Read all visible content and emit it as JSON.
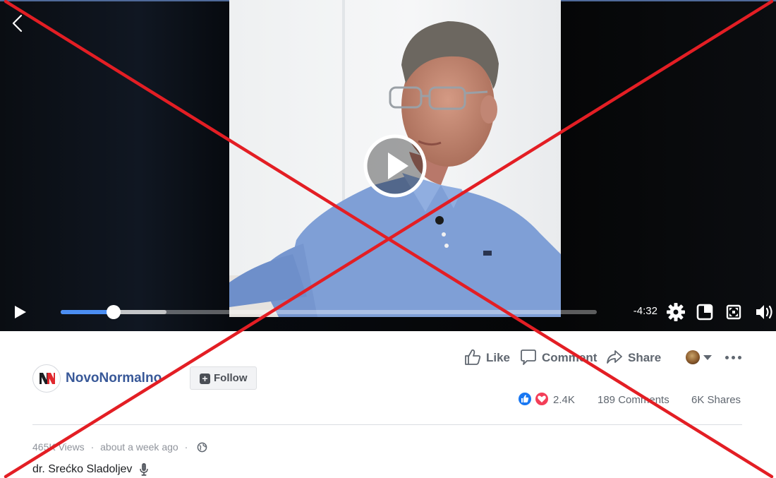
{
  "colors": {
    "accent": "#4b8ef2",
    "link": "#385898",
    "love": "#f33e58",
    "like": "#1877f2",
    "cross": "#e31e24"
  },
  "player": {
    "time_remaining": "-4:32",
    "progress_played": 0.099,
    "progress_buffered": 0.197,
    "icons": [
      "chevron-left-icon",
      "play-icon",
      "gear-icon",
      "picture-in-picture-icon",
      "fullscreen-icon",
      "volume-icon"
    ]
  },
  "post": {
    "page_name": "NovoNormalno",
    "follow_label": "Follow",
    "actions": {
      "like": "Like",
      "comment": "Comment",
      "share": "Share"
    },
    "stats": {
      "reactions": "2.4K",
      "comments": "189 Comments",
      "shares": "6K Shares"
    },
    "views": "465K Views",
    "separator": "·",
    "time_posted": "about a week ago",
    "caption": "dr. Srećko Sladoljev"
  }
}
